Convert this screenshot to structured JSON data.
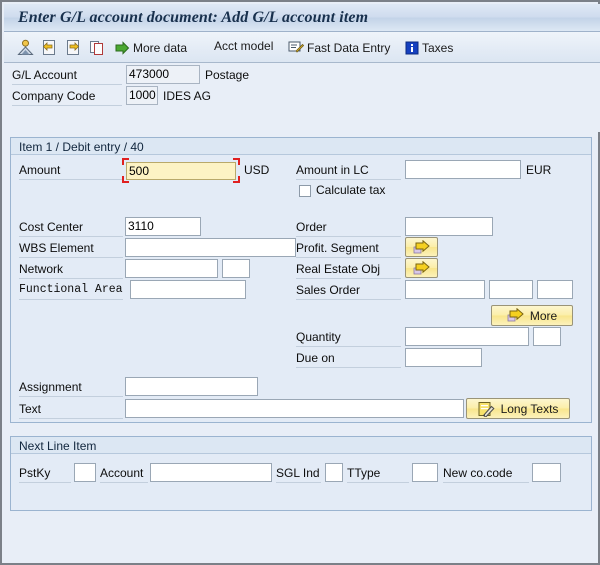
{
  "window": {
    "title": "Enter G/L account document: Add G/L account item"
  },
  "toolbar": {
    "items": [
      {
        "name": "account-person-icon",
        "label": "",
        "icon": "person-account-icon"
      },
      {
        "name": "previous-item-icon",
        "label": "",
        "icon": "document-back-arrow-icon"
      },
      {
        "name": "next-item-icon",
        "label": "",
        "icon": "document-forward-arrow-icon"
      },
      {
        "name": "copy-icon",
        "label": "",
        "icon": "copy-icon"
      },
      {
        "name": "more-data-button",
        "label": "More data",
        "icon": "green-arrow-icon"
      },
      {
        "name": "acct-model-button",
        "label": "Acct model",
        "icon": ""
      },
      {
        "name": "fast-data-entry-button",
        "label": "Fast Data Entry",
        "icon": "fast-entry-icon"
      },
      {
        "name": "taxes-button",
        "label": "Taxes",
        "icon": "info-icon"
      }
    ]
  },
  "header": {
    "gl_account_label": "G/L Account",
    "gl_account_value": "473000",
    "gl_account_text": "Postage",
    "company_code_label": "Company Code",
    "company_code_value": "1000",
    "company_code_text": "IDES AG"
  },
  "item_group": {
    "title": "Item 1 / Debit entry / 40",
    "amount_label": "Amount",
    "amount_value": "500",
    "amount_currency": "USD",
    "amount_lc_label": "Amount in LC",
    "amount_lc_value": "",
    "amount_lc_currency": "EUR",
    "calculate_tax_label": "Calculate tax",
    "calculate_tax_checked": false,
    "cost_center_label": "Cost Center",
    "cost_center_value": "3110",
    "wbs_element_label": "WBS Element",
    "wbs_element_value": "",
    "network_label": "Network",
    "network_value": "",
    "network_value2": "",
    "functional_area_label": "Functional Area",
    "functional_area_value": "",
    "order_label": "Order",
    "order_value": "",
    "profit_segment_label": "Profit. Segment",
    "profit_segment_button": "",
    "real_estate_label": "Real Estate Obj",
    "real_estate_button": "",
    "sales_order_label": "Sales Order",
    "sales_order_value": "",
    "sales_order_value2": "",
    "sales_order_value3": "",
    "more_button_label": "More",
    "quantity_label": "Quantity",
    "quantity_value": "",
    "quantity_unit": "",
    "due_on_label": "Due on",
    "due_on_value": "",
    "assignment_label": "Assignment",
    "assignment_value": "",
    "text_label": "Text",
    "text_value": "",
    "long_texts_button": "Long Texts"
  },
  "next_line_item": {
    "title": "Next Line Item",
    "pstky_label": "PstKy",
    "pstky_value": "",
    "account_label": "Account",
    "account_value": "",
    "sgl_ind_label": "SGL Ind",
    "sgl_ind_value": "",
    "ttype_label": "TType",
    "ttype_value": "",
    "new_cocode_label": "New co.code",
    "new_cocode_value": ""
  },
  "colors": {
    "focus_field": "#fdf3c4",
    "focus_marker": "#e02020",
    "button_yellow": "#f8e58c",
    "group_bg": "#e3ebf6",
    "window_bg": "#e8eef7"
  }
}
